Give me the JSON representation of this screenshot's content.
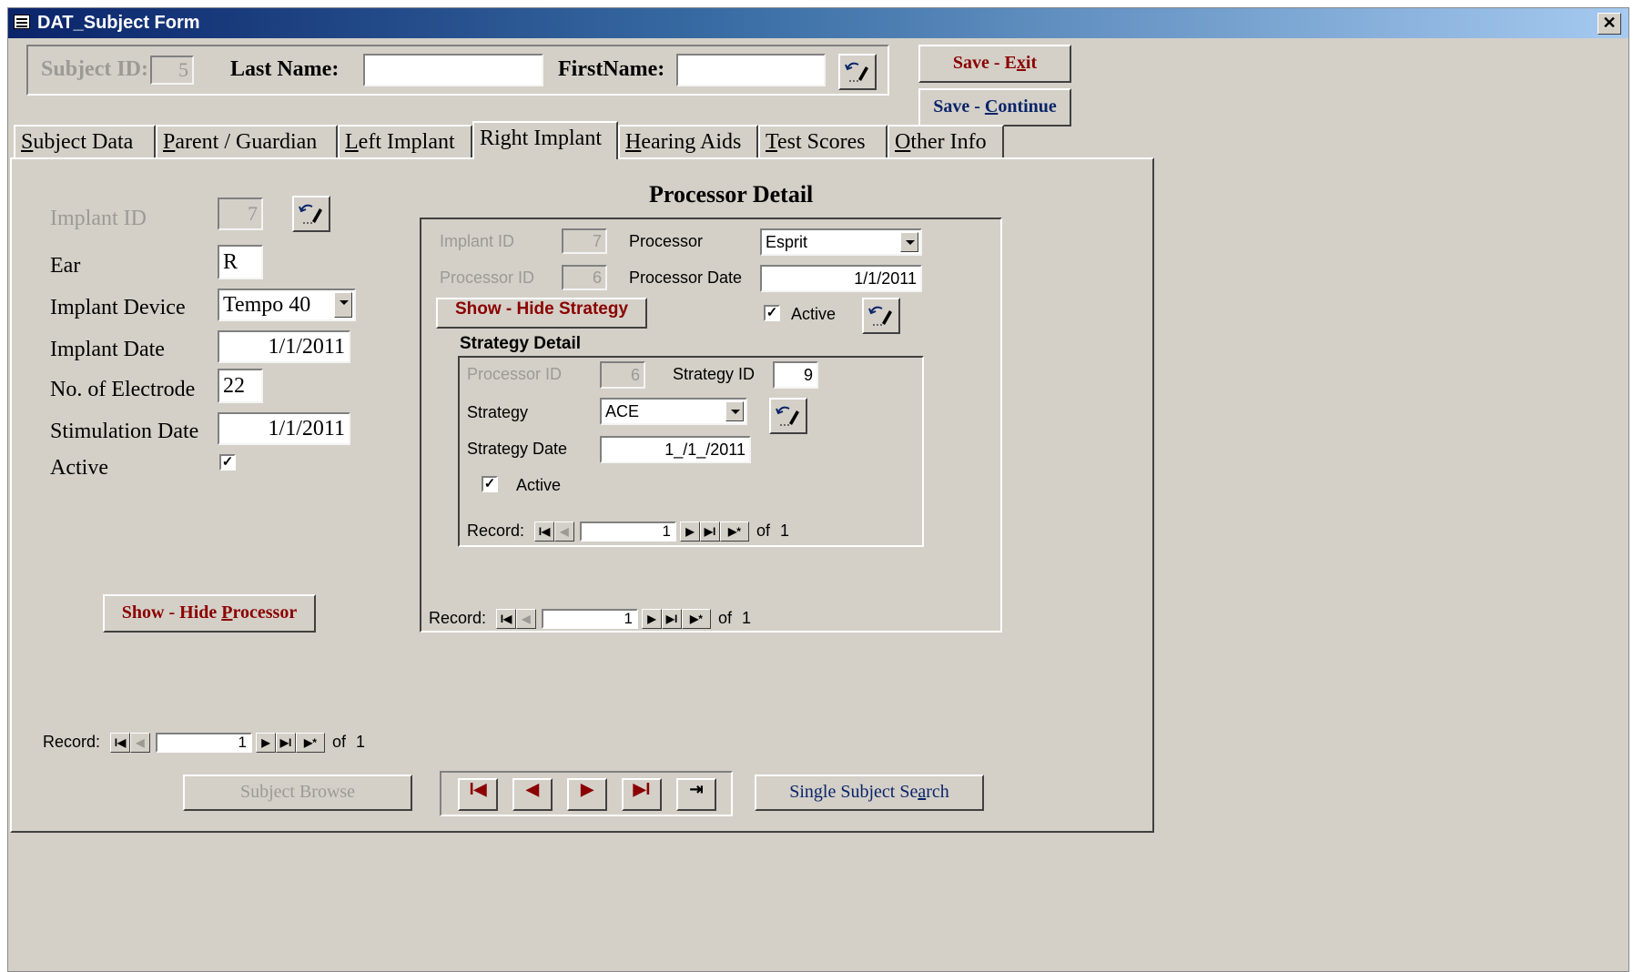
{
  "window": {
    "title": "DAT_Subject Form",
    "close_label": "✕"
  },
  "header": {
    "subject_id_label": "Subject ID:",
    "subject_id_value": "5",
    "last_name_label": "Last Name:",
    "last_name_value": "",
    "first_name_label": "FirstName:",
    "first_name_value": "",
    "save_exit_prefix": "Save - E",
    "save_exit_key": "x",
    "save_exit_suffix": "it",
    "save_continue_prefix": "Save - ",
    "save_continue_key": "C",
    "save_continue_suffix": "ontinue"
  },
  "tabs": [
    {
      "key": "S",
      "rest": "ubject Data"
    },
    {
      "key": "P",
      "rest": "arent / Guardian"
    },
    {
      "key": "L",
      "rest": "eft Implant"
    },
    {
      "key": "",
      "rest": "Right Implant"
    },
    {
      "key": "H",
      "rest": "earing Aids"
    },
    {
      "key": "T",
      "rest": "est Scores"
    },
    {
      "key": "O",
      "rest": "ther Info"
    }
  ],
  "implant": {
    "implant_id_label": "Implant ID",
    "implant_id_value": "7",
    "ear_label": "Ear",
    "ear_value": "R",
    "device_label": "Implant Device",
    "device_value": "Tempo 40",
    "date_label": "Implant Date",
    "date_value": "1/1/2011",
    "electrode_label": "No. of Electrode",
    "electrode_value": "22",
    "stim_label": "Stimulation Date",
    "stim_value": "1/1/2011",
    "active_label": "Active",
    "active_check": "✓",
    "show_hide_prefix": "Show - Hide ",
    "show_hide_key": "P",
    "show_hide_suffix": "rocessor"
  },
  "processor": {
    "title": "Processor Detail",
    "implant_id_label": "Implant ID",
    "implant_id_value": "7",
    "processor_id_label": "Processor ID",
    "processor_id_value": "6",
    "processor_label": "Processor",
    "processor_value": "Esprit",
    "date_label": "Processor Date",
    "date_value": "1/1/2011",
    "active_label": "Active",
    "active_check": "✓",
    "show_hide_label": "Show - Hide Strategy"
  },
  "strategy": {
    "title": "Strategy Detail",
    "processor_id_label": "Processor ID",
    "processor_id_value": "6",
    "strategy_id_label": "Strategy ID",
    "strategy_id_value": "9",
    "strategy_label": "Strategy",
    "strategy_value": "ACE",
    "date_label": "Strategy Date",
    "date_value": "1_/1_/2011",
    "active_label": "Active",
    "active_check": "✓"
  },
  "nav": {
    "record_label": "Record:",
    "of_label": "of",
    "strategy_current": "1",
    "strategy_total": "1",
    "processor_current": "1",
    "processor_total": "1",
    "implant_current": "1",
    "implant_total": "1",
    "first_glyph": "I◀",
    "prev_glyph": "◀",
    "next_glyph": "▶",
    "last_glyph": "▶I",
    "new_glyph": "▶*"
  },
  "footer": {
    "subject_browse_label": "Subject Browse",
    "single_search_prefix": "Single Subject Se",
    "single_search_key": "a",
    "single_search_suffix": "rch",
    "first_glyph": "I◀",
    "prev_glyph": "◀",
    "next_glyph": "▶",
    "last_glyph": "▶I",
    "exit_glyph": "⇥"
  },
  "colors": {
    "title_start": "#0a246a",
    "title_end": "#a6caf0",
    "face": "#d4d0c8",
    "accent_red": "#8b0000",
    "accent_blue": "#0a246a"
  }
}
